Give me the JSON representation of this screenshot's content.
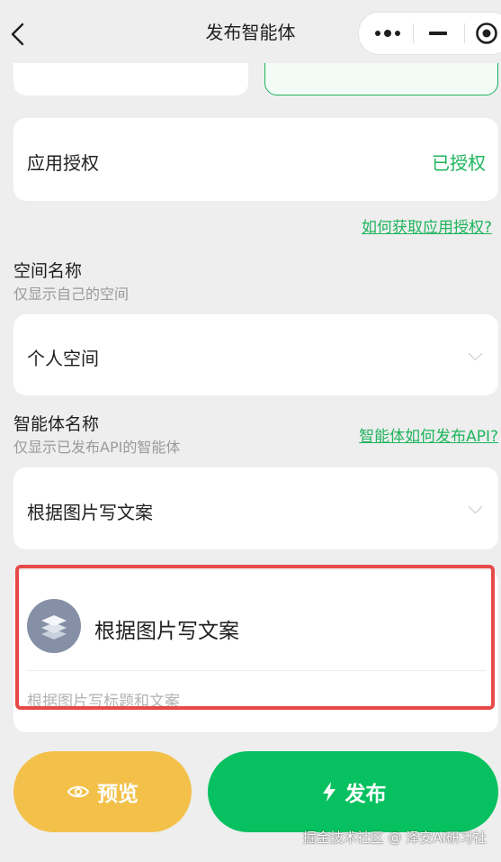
{
  "nav": {
    "title": "发布智能体",
    "back_icon": "chevron-left-icon",
    "more_icon": "more-dots-icon",
    "minimize_icon": "minus-icon",
    "close_icon": "target-circle-icon"
  },
  "auth": {
    "label": "应用授权",
    "status": "已授权",
    "help_link": "如何获取应用授权?"
  },
  "space": {
    "title": "空间名称",
    "subtitle": "仅显示自己的空间",
    "selected": "个人空间"
  },
  "agent": {
    "title": "智能体名称",
    "subtitle": "仅显示已发布API的智能体",
    "help_link": "智能体如何发布API?",
    "selected": "根据图片写文案"
  },
  "agent_card": {
    "name": "根据图片写文案",
    "description": "根据图片写标题和文案",
    "avatar_icon": "stacked-layers-icon"
  },
  "actions": {
    "preview_label": "预览",
    "preview_icon": "eye-icon",
    "publish_label": "发布",
    "publish_icon": "lightning-icon"
  },
  "watermark": "掘金技术社区 @ 泽安AI研习社",
  "colors": {
    "accent_green": "#1fb55e",
    "publish_bg": "#07c160",
    "preview_bg": "#f3c14a",
    "highlight_border": "#e64a47"
  }
}
